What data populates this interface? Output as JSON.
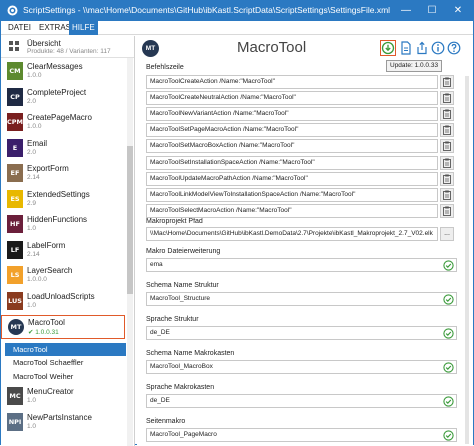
{
  "window": {
    "title": "ScriptSettings - \\\\mac\\Home\\Documents\\GitHub\\ibKastl.ScriptData\\ScriptSettings\\SettingsFile.xml"
  },
  "menu": [
    "DATEI",
    "EXTRAS",
    "HILFE"
  ],
  "sidebar": {
    "overview": {
      "title": "Übersicht",
      "subtitle": "Produkte: 48 / Varianten: 117"
    },
    "items": [
      {
        "badge": "CM",
        "color": "#5d8a2f",
        "name": "ClearMessages",
        "version": "1.0.0"
      },
      {
        "badge": "CP",
        "color": "#1f2a44",
        "name": "CompleteProject",
        "version": "2.0"
      },
      {
        "badge": "CPM",
        "color": "#7a1f1f",
        "name": "CreatePageMacro",
        "version": "1.0.0"
      },
      {
        "badge": "E",
        "color": "#3b1f6b",
        "name": "Email",
        "version": "2.0"
      },
      {
        "badge": "EF",
        "color": "#8a6d4f",
        "name": "ExportForm",
        "version": "2.14"
      },
      {
        "badge": "ES",
        "color": "#e8b800",
        "name": "ExtendedSettings",
        "version": "2.9"
      },
      {
        "badge": "HF",
        "color": "#6b1f3b",
        "name": "HiddenFunctions",
        "version": "1.0"
      },
      {
        "badge": "LF",
        "color": "#1a1a1a",
        "name": "LabelForm",
        "version": "2.14"
      },
      {
        "badge": "LS",
        "color": "#f2a12b",
        "name": "LayerSearch",
        "version": "1.0.0.0"
      },
      {
        "badge": "LUS",
        "color": "#8a3b1f",
        "name": "LoadUnloadScripts",
        "version": "1.0"
      },
      {
        "badge": "MT",
        "color": "#263853",
        "name": "MacroTool",
        "version": "1.0.0.31"
      },
      {
        "badge": "MC",
        "color": "#4a4a4a",
        "name": "MenuCreator",
        "version": "1.0"
      },
      {
        "badge": "NPI",
        "color": "#5c6f85",
        "name": "NewPartsInstance",
        "version": "1.0"
      }
    ],
    "subitems": [
      "MacroTool",
      "MacroTool Schaeffler",
      "MacroTool Weiher"
    ]
  },
  "main": {
    "avatar": "MT",
    "title": "MacroTool",
    "tooltip": "Update: 1.0.0.33",
    "befehlszeile_label": "Befehlszeile",
    "commands": [
      "MacroToolCreateAction /Name:\"MacroTool\"",
      "MacroToolCreateNeutralAction /Name:\"MacroTool\"",
      "MacroToolNewVariantAction /Name:\"MacroTool\"",
      "MacroToolSetPageMacroAction /Name:\"MacroTool\"",
      "MacroToolSetMacroBoxAction /Name:\"MacroTool\"",
      "MacroToolSetInstallationSpaceAction /Name:\"MacroTool\"",
      "MacroToolUpdateMacroPathAction /Name:\"MacroTool\"",
      "MacroToolLinkModelViewToInstallationSpaceAction /Name:\"MacroTool\"",
      "MacroToolSelectMacroAction /Name:\"MacroTool\""
    ],
    "makroprojekt_label": "Makroprojekt Pfad",
    "makroprojekt_value": "\\\\Mac\\Home\\Documents\\GitHub\\ibKastl.DemoData\\2.7\\Projekte\\ibKastl_Makroprojekt_2.7_V02.elk",
    "browse_label": "...",
    "settings": [
      {
        "label": "Makro Dateierweiterung",
        "value": "ema"
      },
      {
        "label": "Schema Name Struktur",
        "value": "MacroTool_Structure"
      },
      {
        "label": "Sprache Struktur",
        "value": "de_DE"
      },
      {
        "label": "Schema Name Makrokasten",
        "value": "MacroTool_MacroBox"
      },
      {
        "label": "Sprache Makrokasten",
        "value": "de_DE"
      },
      {
        "label": "Seitenmakro",
        "value": "MacroTool_PageMacro"
      }
    ]
  },
  "colors": {
    "accent": "#2b79c2",
    "highlight": "#e05a2a",
    "ok": "#3a9a3a"
  }
}
